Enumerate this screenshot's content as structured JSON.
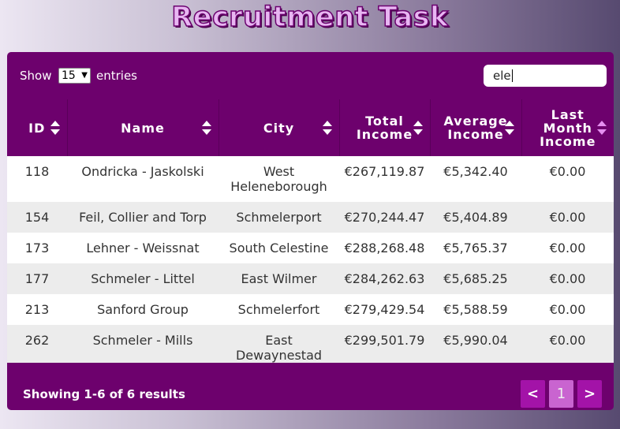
{
  "app": {
    "title": "Recruitment Task"
  },
  "controls": {
    "show_label": "Show",
    "entries_value": "15",
    "entries_label": "entries",
    "search_value": "ele"
  },
  "table": {
    "columns": [
      {
        "lines": [
          "ID"
        ],
        "sort_active": false
      },
      {
        "lines": [
          "Name"
        ],
        "sort_active": false
      },
      {
        "lines": [
          "City"
        ],
        "sort_active": false
      },
      {
        "lines": [
          "Total",
          "Income"
        ],
        "sort_active": false
      },
      {
        "lines": [
          "Average",
          "Income"
        ],
        "sort_active": false
      },
      {
        "lines": [
          "Last",
          "Month",
          "Income"
        ],
        "sort_active": true
      }
    ],
    "rows": [
      [
        "118",
        "Ondricka - Jaskolski",
        "West Heleneborough",
        "€267,119.87",
        "€5,342.40",
        "€0.00"
      ],
      [
        "154",
        "Feil, Collier and Torp",
        "Schmelerport",
        "€270,244.47",
        "€5,404.89",
        "€0.00"
      ],
      [
        "173",
        "Lehner - Weissnat",
        "South Celestine",
        "€288,268.48",
        "€5,765.37",
        "€0.00"
      ],
      [
        "177",
        "Schmeler - Littel",
        "East Wilmer",
        "€284,262.63",
        "€5,685.25",
        "€0.00"
      ],
      [
        "213",
        "Sanford Group",
        "Schmelerfort",
        "€279,429.54",
        "€5,588.59",
        "€0.00"
      ],
      [
        "262",
        "Schmeler - Mills",
        "East Dewaynestad",
        "€299,501.79",
        "€5,990.04",
        "€0.00"
      ]
    ]
  },
  "footer": {
    "results_text": "Showing 1-6 of 6 results",
    "prev_label": "<",
    "current_page": "1",
    "next_label": ">"
  },
  "colors": {
    "accent": "#6d016d",
    "page_button": "#a313a8",
    "page_button_active": "#c964d0",
    "row_alt": "#ececec"
  }
}
